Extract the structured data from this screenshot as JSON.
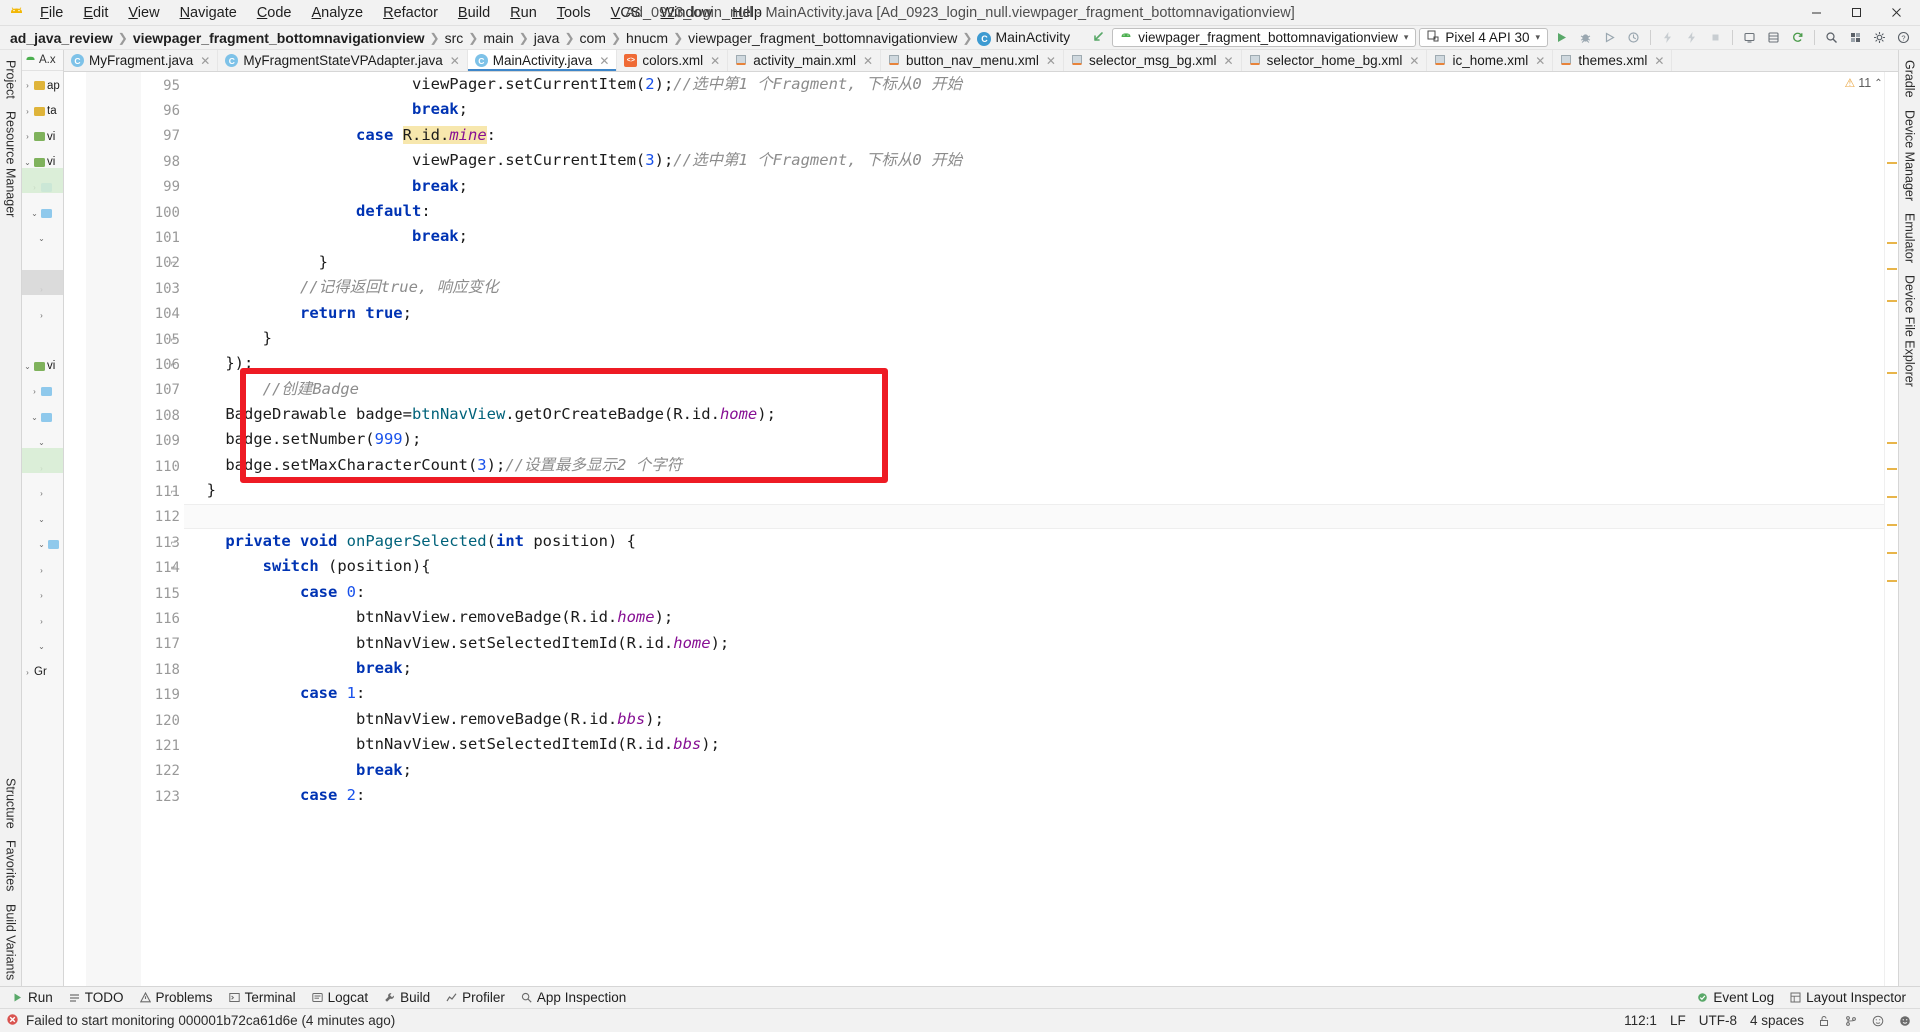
{
  "titlebar": {
    "logo_icon": "android-logo-icon",
    "window_title": "Ad_0923_login_null - MainActivity.java [Ad_0923_login_null.viewpager_fragment_bottomnavigationview]",
    "menus": [
      {
        "label": "File"
      },
      {
        "label": "Edit"
      },
      {
        "label": "View"
      },
      {
        "label": "Navigate"
      },
      {
        "label": "Code"
      },
      {
        "label": "Analyze"
      },
      {
        "label": "Refactor"
      },
      {
        "label": "Build"
      },
      {
        "label": "Run"
      },
      {
        "label": "Tools"
      },
      {
        "label": "VCS"
      },
      {
        "label": "Window"
      },
      {
        "label": "Help"
      }
    ],
    "window_buttons": [
      {
        "name": "minimize-button",
        "glyph": "—"
      },
      {
        "name": "maximize-button",
        "glyph": "▢"
      },
      {
        "name": "close-button",
        "glyph": "✕"
      }
    ]
  },
  "navbar": {
    "breadcrumbs": [
      {
        "label": "ad_java_review",
        "bold": true
      },
      {
        "label": "viewpager_fragment_bottomnavigationview",
        "bold": true
      },
      {
        "label": "src",
        "bold": false
      },
      {
        "label": "main",
        "bold": false
      },
      {
        "label": "java",
        "bold": false
      },
      {
        "label": "com",
        "bold": false
      },
      {
        "label": "hnucm",
        "bold": false
      },
      {
        "label": "viewpager_fragment_bottomnavigationview",
        "bold": false
      },
      {
        "label": "MainActivity",
        "bold": false,
        "icon": "class-icon"
      }
    ],
    "separator": "❯",
    "back_icon": "back-arrow-icon",
    "run_config": {
      "label": "viewpager_fragment_bottomnavigationview",
      "icon": "android-icon",
      "chevron": "▾"
    },
    "device": {
      "label": "Pixel 4 API 30",
      "icon": "device-icon",
      "chevron": "▾"
    },
    "toolbar_icons": [
      {
        "name": "run-button",
        "glyph": "▶"
      },
      {
        "name": "debug-button",
        "glyph": "🐞"
      },
      {
        "name": "run-with-coverage-button",
        "glyph": "▷"
      },
      {
        "name": "profiler-button",
        "glyph": "⏱"
      },
      {
        "name": "apply-changes-button",
        "glyph": "⚡"
      },
      {
        "name": "apply-code-changes-button",
        "glyph": "⚡"
      },
      {
        "name": "stop-button",
        "glyph": "■"
      },
      {
        "name": "avd-manager-button",
        "glyph": "▭"
      },
      {
        "name": "sdk-manager-button",
        "glyph": "▤"
      },
      {
        "name": "sync-gradle-button",
        "glyph": "⟳"
      },
      {
        "name": "search-everywhere-button",
        "glyph": "🔍"
      },
      {
        "name": "project-structure-button",
        "glyph": "▦"
      },
      {
        "name": "settings-button",
        "glyph": "⚙"
      },
      {
        "name": "help-button",
        "glyph": "❓"
      }
    ]
  },
  "left_strip": {
    "items": [
      {
        "label": "Project",
        "name": "tool-window-project"
      },
      {
        "label": "Resource Manager",
        "name": "tool-window-resource-manager"
      },
      {
        "label": "Structure",
        "name": "tool-window-structure"
      },
      {
        "label": "Favorites",
        "name": "tool-window-favorites"
      },
      {
        "label": "Build Variants",
        "name": "tool-window-build-variants"
      }
    ]
  },
  "right_strip": {
    "items": [
      {
        "label": "Gradle",
        "name": "tool-window-gradle"
      },
      {
        "label": "Device Manager",
        "name": "tool-window-device-manager"
      },
      {
        "label": "Emulator",
        "name": "tool-window-emulator"
      },
      {
        "label": "Device File Explorer",
        "name": "tool-window-device-file-explorer"
      }
    ]
  },
  "project_panel": {
    "title": "A.x",
    "tree": [
      {
        "label": "ap",
        "depth": 0,
        "folder": "yellow",
        "arrow": "›"
      },
      {
        "label": "ta",
        "depth": 0,
        "folder": "yellow",
        "arrow": "›"
      },
      {
        "label": "vi",
        "depth": 0,
        "folder": "green",
        "arrow": "›"
      },
      {
        "label": "vi",
        "depth": 0,
        "folder": "green",
        "arrow": "⌄"
      },
      {
        "label": "",
        "depth": 1,
        "folder": "blue",
        "arrow": "›"
      },
      {
        "label": "",
        "depth": 1,
        "folder": "blue",
        "arrow": "⌄"
      },
      {
        "label": "",
        "depth": 2,
        "folder": "",
        "arrow": "⌄"
      },
      {
        "label": "",
        "depth": 2,
        "folder": "",
        "arrow": ""
      },
      {
        "label": "",
        "depth": 2,
        "folder": "",
        "arrow": "›"
      },
      {
        "label": "",
        "depth": 2,
        "folder": "",
        "arrow": "›"
      },
      {
        "label": "",
        "depth": 2,
        "folder": "",
        "arrow": ""
      },
      {
        "label": "vi",
        "depth": 0,
        "folder": "green",
        "arrow": "⌄"
      },
      {
        "label": "",
        "depth": 1,
        "folder": "blue",
        "arrow": "›"
      },
      {
        "label": "",
        "depth": 1,
        "folder": "blue",
        "arrow": "⌄"
      },
      {
        "label": "",
        "depth": 2,
        "folder": "",
        "arrow": "⌄"
      },
      {
        "label": "",
        "depth": 2,
        "folder": "",
        "arrow": "›"
      },
      {
        "label": "",
        "depth": 2,
        "folder": "",
        "arrow": "›"
      },
      {
        "label": "",
        "depth": 2,
        "folder": "",
        "arrow": "⌄"
      },
      {
        "label": "",
        "depth": 2,
        "folder": "blue",
        "arrow": "⌄"
      },
      {
        "label": "",
        "depth": 2,
        "folder": "",
        "arrow": "›"
      },
      {
        "label": "",
        "depth": 2,
        "folder": "",
        "arrow": "›"
      },
      {
        "label": "",
        "depth": 2,
        "folder": "",
        "arrow": "›"
      },
      {
        "label": "",
        "depth": 2,
        "folder": "",
        "arrow": "⌄"
      },
      {
        "label": "Gr",
        "depth": 0,
        "folder": "",
        "arrow": "›"
      }
    ]
  },
  "editor_tabs": [
    {
      "label": "MyFragment.java",
      "type": "java",
      "active": false
    },
    {
      "label": "MyFragmentStateVPAdapter.java",
      "type": "java",
      "active": false
    },
    {
      "label": "MainActivity.java",
      "type": "java",
      "active": true
    },
    {
      "label": "colors.xml",
      "type": "xml",
      "active": false
    },
    {
      "label": "activity_main.xml",
      "type": "res",
      "active": false
    },
    {
      "label": "button_nav_menu.xml",
      "type": "res",
      "active": false
    },
    {
      "label": "selector_msg_bg.xml",
      "type": "res",
      "active": false
    },
    {
      "label": "selector_home_bg.xml",
      "type": "res",
      "active": false
    },
    {
      "label": "ic_home.xml",
      "type": "res",
      "active": false
    },
    {
      "label": "themes.xml",
      "type": "res",
      "active": false
    }
  ],
  "inspection_widget": {
    "count": "11",
    "warn_icon": "warning-triangle-icon",
    "up": "⌃",
    "down": "⌄"
  },
  "editor": {
    "first_line_number": 95,
    "cursor_line_index": 17,
    "lines": [
      {
        "n": 95,
        "indent": 12,
        "tokens": [
          {
            "t": "viewPager",
            "c": ""
          },
          {
            "t": ".",
            "c": ""
          },
          {
            "t": "setCurrentItem",
            "c": ""
          },
          {
            "t": "(",
            "c": ""
          },
          {
            "t": "2",
            "c": "num"
          },
          {
            "t": ");",
            "c": ""
          },
          {
            "t": "//选中第1 个Fragment, 下标从0 开始",
            "c": "cmt"
          }
        ]
      },
      {
        "n": 96,
        "indent": 12,
        "tokens": [
          {
            "t": "break",
            "c": "kw"
          },
          {
            "t": ";",
            "c": ""
          }
        ]
      },
      {
        "n": 97,
        "indent": 9,
        "tokens": [
          {
            "t": "case ",
            "c": "kw"
          },
          {
            "t": "R.id.",
            "c": "hl"
          },
          {
            "t": "mine",
            "c": "hl fld"
          },
          {
            "t": ":",
            "c": ""
          }
        ]
      },
      {
        "n": 98,
        "indent": 12,
        "tokens": [
          {
            "t": "viewPager",
            "c": ""
          },
          {
            "t": ".",
            "c": ""
          },
          {
            "t": "setCurrentItem",
            "c": ""
          },
          {
            "t": "(",
            "c": ""
          },
          {
            "t": "3",
            "c": "num"
          },
          {
            "t": ");",
            "c": ""
          },
          {
            "t": "//选中第1 个Fragment, 下标从0 开始",
            "c": "cmt"
          }
        ]
      },
      {
        "n": 99,
        "indent": 12,
        "tokens": [
          {
            "t": "break",
            "c": "kw"
          },
          {
            "t": ";",
            "c": ""
          }
        ]
      },
      {
        "n": 100,
        "indent": 9,
        "tokens": [
          {
            "t": "default",
            "c": "kw"
          },
          {
            "t": ":",
            "c": ""
          }
        ]
      },
      {
        "n": 101,
        "indent": 12,
        "tokens": [
          {
            "t": "break",
            "c": "kw"
          },
          {
            "t": ";",
            "c": ""
          }
        ]
      },
      {
        "n": 102,
        "indent": 7,
        "tokens": [
          {
            "t": "}",
            "c": ""
          }
        ]
      },
      {
        "n": 103,
        "indent": 6,
        "tokens": [
          {
            "t": "//记得返回true, 响应变化",
            "c": "cmt"
          }
        ]
      },
      {
        "n": 104,
        "indent": 6,
        "tokens": [
          {
            "t": "return ",
            "c": "kw"
          },
          {
            "t": "true",
            "c": "kw"
          },
          {
            "t": ";",
            "c": ""
          }
        ]
      },
      {
        "n": 105,
        "indent": 4,
        "tokens": [
          {
            "t": "}",
            "c": ""
          }
        ]
      },
      {
        "n": 106,
        "indent": 2,
        "tokens": [
          {
            "t": "});",
            "c": ""
          }
        ]
      },
      {
        "n": 107,
        "indent": 4,
        "tokens": [
          {
            "t": "//创建Badge",
            "c": "cmt"
          }
        ]
      },
      {
        "n": 108,
        "indent": 2,
        "tokens": [
          {
            "t": "BadgeDrawable badge=",
            "c": ""
          },
          {
            "t": "btnNavView",
            "c": "mth"
          },
          {
            "t": ".getOrCreateBadge(R.id.",
            "c": ""
          },
          {
            "t": "home",
            "c": "fld"
          },
          {
            "t": ");",
            "c": ""
          }
        ]
      },
      {
        "n": 109,
        "indent": 2,
        "tokens": [
          {
            "t": "badge.setNumber(",
            "c": ""
          },
          {
            "t": "999",
            "c": "num"
          },
          {
            "t": ");",
            "c": ""
          }
        ]
      },
      {
        "n": 110,
        "indent": 2,
        "tokens": [
          {
            "t": "badge.setMaxCharacterCount(",
            "c": ""
          },
          {
            "t": "3",
            "c": "num"
          },
          {
            "t": ");",
            "c": ""
          },
          {
            "t": "//设置最多显示2 个字符",
            "c": "cmt"
          }
        ]
      },
      {
        "n": 111,
        "indent": 1,
        "tokens": [
          {
            "t": "}",
            "c": ""
          }
        ]
      },
      {
        "n": 112,
        "indent": 0,
        "tokens": [
          {
            "t": "",
            "c": "caret"
          }
        ]
      },
      {
        "n": 113,
        "indent": 2,
        "tokens": [
          {
            "t": "private ",
            "c": "kw"
          },
          {
            "t": "void ",
            "c": "kw"
          },
          {
            "t": "onPagerSelected",
            "c": "mth"
          },
          {
            "t": "(",
            "c": ""
          },
          {
            "t": "int ",
            "c": "kw"
          },
          {
            "t": "position) {",
            "c": ""
          }
        ]
      },
      {
        "n": 114,
        "indent": 4,
        "tokens": [
          {
            "t": "switch ",
            "c": "kw"
          },
          {
            "t": "(position){",
            "c": ""
          }
        ]
      },
      {
        "n": 115,
        "indent": 6,
        "tokens": [
          {
            "t": "case ",
            "c": "kw"
          },
          {
            "t": "0",
            "c": "num"
          },
          {
            "t": ":",
            "c": ""
          }
        ]
      },
      {
        "n": 116,
        "indent": 9,
        "tokens": [
          {
            "t": "btnNavView",
            "c": ""
          },
          {
            "t": ".removeBadge(R.id.",
            "c": ""
          },
          {
            "t": "home",
            "c": "fld"
          },
          {
            "t": ");",
            "c": ""
          }
        ]
      },
      {
        "n": 117,
        "indent": 9,
        "tokens": [
          {
            "t": "btnNavView",
            "c": ""
          },
          {
            "t": ".setSelectedItemId(R.id.",
            "c": ""
          },
          {
            "t": "home",
            "c": "fld"
          },
          {
            "t": ");",
            "c": ""
          }
        ]
      },
      {
        "n": 118,
        "indent": 9,
        "tokens": [
          {
            "t": "break",
            "c": "kw"
          },
          {
            "t": ";",
            "c": ""
          }
        ]
      },
      {
        "n": 119,
        "indent": 6,
        "tokens": [
          {
            "t": "case ",
            "c": "kw"
          },
          {
            "t": "1",
            "c": "num"
          },
          {
            "t": ":",
            "c": ""
          }
        ]
      },
      {
        "n": 120,
        "indent": 9,
        "tokens": [
          {
            "t": "btnNavView",
            "c": ""
          },
          {
            "t": ".removeBadge(R.id.",
            "c": ""
          },
          {
            "t": "bbs",
            "c": "fld"
          },
          {
            "t": ");",
            "c": ""
          }
        ]
      },
      {
        "n": 121,
        "indent": 9,
        "tokens": [
          {
            "t": "btnNavView",
            "c": ""
          },
          {
            "t": ".setSelectedItemId(R.id.",
            "c": ""
          },
          {
            "t": "bbs",
            "c": "fld"
          },
          {
            "t": ");",
            "c": ""
          }
        ]
      },
      {
        "n": 122,
        "indent": 9,
        "tokens": [
          {
            "t": "break",
            "c": "kw"
          },
          {
            "t": ";",
            "c": ""
          }
        ]
      },
      {
        "n": 123,
        "indent": 6,
        "tokens": [
          {
            "t": "case ",
            "c": "kw"
          },
          {
            "t": "2",
            "c": "num"
          },
          {
            "t": ":",
            "c": ""
          }
        ]
      }
    ],
    "commented_marker": "//",
    "fold_lines": [
      102,
      105,
      106,
      111,
      113,
      114
    ]
  },
  "highlight_box": {
    "color": "#ee1b24"
  },
  "bottom_toolbar": {
    "items": [
      {
        "label": "Run",
        "icon": "run-icon",
        "name": "tool-run"
      },
      {
        "label": "TODO",
        "icon": "todo-icon",
        "name": "tool-todo"
      },
      {
        "label": "Problems",
        "icon": "problems-icon",
        "name": "tool-problems"
      },
      {
        "label": "Terminal",
        "icon": "terminal-icon",
        "name": "tool-terminal"
      },
      {
        "label": "Logcat",
        "icon": "logcat-icon",
        "name": "tool-logcat"
      },
      {
        "label": "Build",
        "icon": "build-icon",
        "name": "tool-build"
      },
      {
        "label": "Profiler",
        "icon": "profiler-icon",
        "name": "tool-profiler"
      },
      {
        "label": "App Inspection",
        "icon": "app-inspection-icon",
        "name": "tool-app-inspection"
      }
    ],
    "right_items": [
      {
        "label": "Event Log",
        "icon": "event-log-icon",
        "name": "tool-event-log"
      },
      {
        "label": "Layout Inspector",
        "icon": "layout-inspector-icon",
        "name": "tool-layout-inspector"
      }
    ]
  },
  "statusbar": {
    "message": "Failed to start monitoring 000001b72ca61d6e (4 minutes ago)",
    "message_icon": "error-icon",
    "caret_position": "112:1",
    "line_separator": "LF",
    "encoding": "UTF-8",
    "indent": "4 spaces",
    "right_icons": [
      {
        "name": "lock-icon",
        "glyph": "🔓"
      },
      {
        "name": "branch-icon",
        "glyph": "⑂"
      },
      {
        "name": "inspection-icon",
        "glyph": "☺"
      },
      {
        "name": "notification-icon",
        "glyph": "☻"
      }
    ]
  }
}
